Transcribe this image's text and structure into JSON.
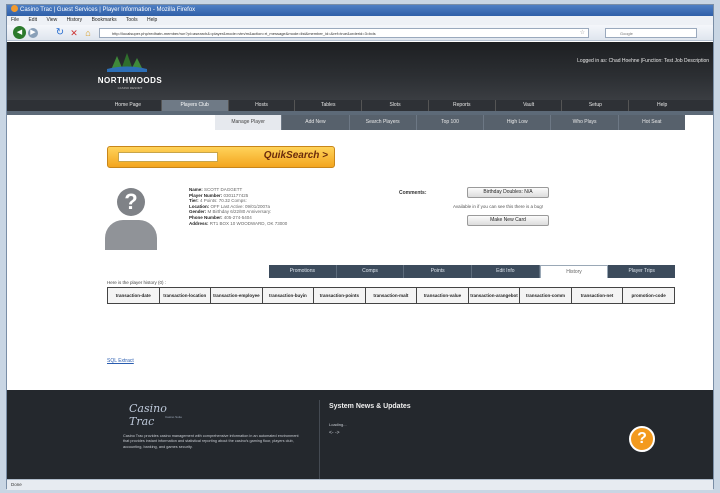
{
  "window": {
    "title": "Casino Trac | Guest Services | Player Information - Mozilla Firefox",
    "menu": [
      "File",
      "Edit",
      "View",
      "History",
      "Bookmarks",
      "Tools",
      "Help"
    ]
  },
  "browser": {
    "url": "http://localsuper.php/redhatn-member/run?pl=asearch&=player&mode=vtm/m&action=rt_message&mode=list&member_id=&ref=true&orderid=3=bds",
    "search_placeholder": "Google",
    "status": "Done"
  },
  "header": {
    "logo_text": "NORTHWOODS",
    "logo_sub": "CASINO RESORT",
    "login_info": "Logged in as: Chad Hoehne  |Function: Test Job Description"
  },
  "main_menu": [
    {
      "label": "Home Page",
      "active": false
    },
    {
      "label": "Players Club",
      "active": true
    },
    {
      "label": "Hosts",
      "active": false
    },
    {
      "label": "Tables",
      "active": false
    },
    {
      "label": "Slots",
      "active": false
    },
    {
      "label": "Reports",
      "active": false
    },
    {
      "label": "Vault",
      "active": false
    },
    {
      "label": "Setup",
      "active": false
    },
    {
      "label": "Help",
      "active": false
    }
  ],
  "sub_menu": [
    {
      "label": "Manage Player",
      "active": true
    },
    {
      "label": "Add New",
      "active": false
    },
    {
      "label": "Search Players",
      "active": false
    },
    {
      "label": "Top 100",
      "active": false
    },
    {
      "label": "High Low",
      "active": false
    },
    {
      "label": "Who Plays",
      "active": false
    },
    {
      "label": "Hot Seat",
      "active": false
    }
  ],
  "quicksearch": {
    "label": "QuikSearch >",
    "value": ""
  },
  "player": {
    "fields": [
      {
        "label": "Name:",
        "value": "SCOTT DAGGETT"
      },
      {
        "label": "Player Number:",
        "value": "0301177425"
      },
      {
        "label": "Tier:",
        "value": "4  Points: 70.32  Comps:"
      },
      {
        "label": "Location:",
        "value": "OFF  Last Active: 09/01/2007a"
      },
      {
        "label": "Gender:",
        "value": "M  Birthday 6/22/80  Anniversary:"
      },
      {
        "label": "Phone Number:",
        "value": "405-274-5404"
      },
      {
        "label": "Address:",
        "value": "RT1 BOX 10 WOODWARD, OK 73000"
      }
    ],
    "comments_label": "Comments:",
    "birthday_button": "Birthday Doubles: N/A",
    "bug_note": "Available in if you can see this there is a bug!",
    "new_card_button": "Make New Card"
  },
  "tabs": [
    {
      "label": "Promotions",
      "active": false
    },
    {
      "label": "Comps",
      "active": false
    },
    {
      "label": "Points",
      "active": false
    },
    {
      "label": "Edit Info",
      "active": false
    },
    {
      "label": "History",
      "active": true
    },
    {
      "label": "Player Trips",
      "active": false
    }
  ],
  "history": {
    "note": "Here is the player history (0) :",
    "columns": [
      "transaction-date",
      "transaction-location",
      "transaction-employee",
      "transaction-buyin",
      "transaction-points",
      "transaction-malt",
      "transaction-value",
      "transaction-arangebot",
      "transaction-comm",
      "transaction-net",
      "promotion-code"
    ],
    "export_link": "SQL Extract"
  },
  "footer": {
    "logo_text": "Casino Trac",
    "logo_sub": "Casino Suite",
    "description": "Casino Trac provides casino management with comprehensive information in an automated environment that provides instant information and statistical reporting about the casino's gaming floor, players club, accounting, banking, and games security.",
    "news_title": "System News & Updates",
    "news_loading": "Loading...",
    "news_arrows": "<- ->"
  },
  "colors": {
    "accent": "#f3a51e",
    "header_dark": "#24282d",
    "menu_active": "#6f7a86",
    "tab_bg": "#3c4b5c"
  }
}
